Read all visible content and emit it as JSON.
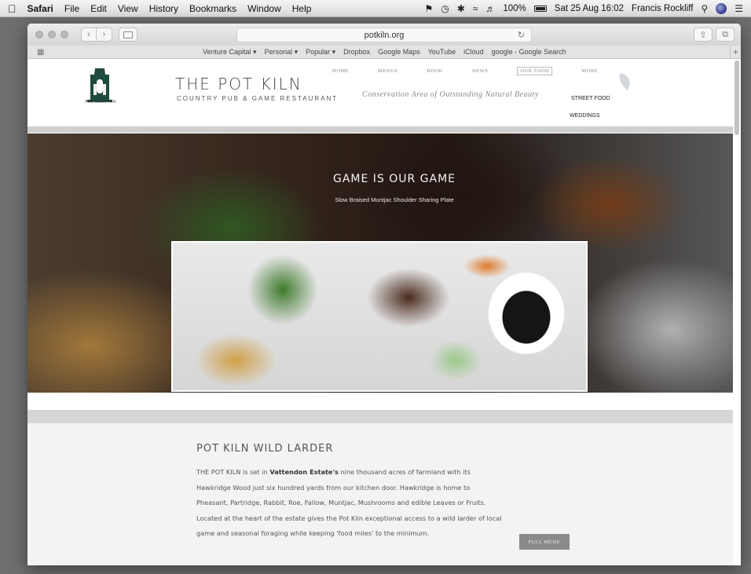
{
  "menubar": {
    "app": "Safari",
    "items": [
      "File",
      "Edit",
      "View",
      "History",
      "Bookmarks",
      "Window",
      "Help"
    ],
    "battery": "100%",
    "clock": "Sat 25 Aug 16:02",
    "user": "Francis Rockliff"
  },
  "browser": {
    "url": "potkiln.org",
    "favorites": [
      "Venture Capital ▾",
      "Personal ▾",
      "Popular ▾",
      "Dropbox",
      "Google Maps",
      "YouTube",
      "iCloud",
      "google - Google Search"
    ]
  },
  "site": {
    "logo_text": "POT KILN INN",
    "title": "THE POT KILN",
    "tagline": "COUNTRY PUB & GAME RESTAURANT",
    "strapline": "Conservation Area of Outstanding Natural Beauty",
    "nav": [
      "HOME",
      "MENUS",
      "BOOK",
      "NEWS",
      "OUR FOOD",
      "MORE"
    ],
    "dropdown": [
      "STREET FOOD",
      "WEDDINGS"
    ]
  },
  "hero": {
    "title": "GAME IS OUR GAME",
    "subtitle": "Slow Braised Muntjac Shoulder Sharing Plate"
  },
  "larder": {
    "title": "POT KILN WILD LARDER",
    "body_intro": "THE POT KILN is set in ",
    "body_bold": "Vattendon Estate's",
    "body_rest": " nine thousand acres of farmland with its Hawkridge Wood just six hundred yards from our kitchen door. Hawkridge is home to Pheasant, Partridge, Rabbit, Roe, Fallow, Muntjac, Mushrooms and edible Leaves or Fruits. Located at the heart of the estate gives the Pot Kiln exceptional access to a wild larder of local game and seasonal foraging while keeping 'food miles' to the minimum.",
    "button": "FULL MENU"
  }
}
